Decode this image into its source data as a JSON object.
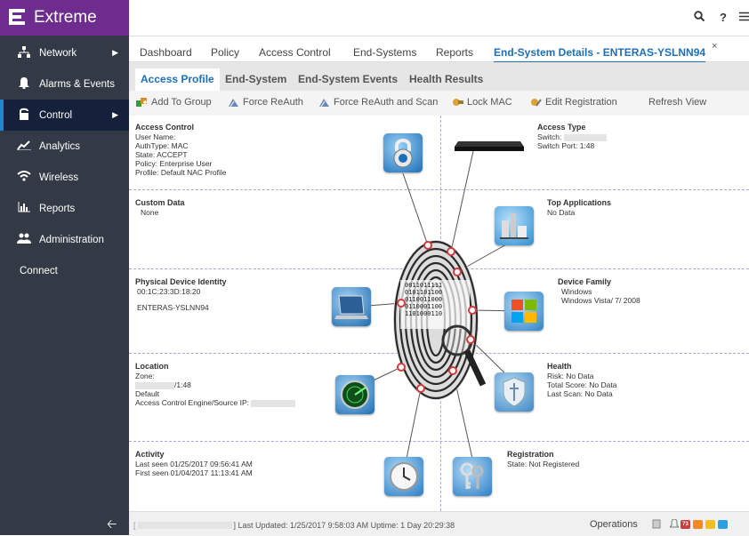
{
  "brand": {
    "name": "Extreme"
  },
  "sidebar": {
    "items": [
      {
        "label": "Network",
        "icon": "network-icon"
      },
      {
        "label": "Alarms & Events",
        "icon": "bell-icon"
      },
      {
        "label": "Control",
        "icon": "lock-icon"
      },
      {
        "label": "Analytics",
        "icon": "analytics-icon"
      },
      {
        "label": "Wireless",
        "icon": "wifi-icon"
      },
      {
        "label": "Reports",
        "icon": "bar-chart-icon"
      },
      {
        "label": "Administration",
        "icon": "users-icon"
      }
    ],
    "connect": "Connect",
    "collapse_icon": "arrow-left-icon"
  },
  "topbar": {
    "icons": [
      "search-icon",
      "help-icon",
      "menu-icon"
    ],
    "help": "?"
  },
  "tabs": [
    "Dashboard",
    "Policy",
    "Access Control",
    "End-Systems",
    "Reports",
    "End-System Details - ENTERAS-YSLNN94"
  ],
  "tab_close": "×",
  "subtabs": [
    "Access Profile",
    "End-System",
    "End-System Events",
    "Health Results"
  ],
  "toolbar": {
    "add_to_group": "Add To Group",
    "force_reauth": "Force ReAuth",
    "force_reauth_scan": "Force ReAuth and Scan",
    "lock_mac": "Lock MAC",
    "edit_registration": "Edit Registration",
    "refresh_view": "Refresh View"
  },
  "sections": {
    "access_control": {
      "title": "Access Control",
      "user_name": "User Name:",
      "auth_type": "AuthType: MAC",
      "state": "State: ACCEPT",
      "policy": "Policy: Enterprise User",
      "profile": "Profile: Default NAC Profile"
    },
    "access_type": {
      "title": "Access Type",
      "switch": "Switch:",
      "switch_port": "Switch Port: 1:48"
    },
    "custom_data": {
      "title": "Custom Data",
      "value": "None"
    },
    "top_applications": {
      "title": "Top Applications",
      "value": "No Data"
    },
    "physical_device": {
      "title": "Physical Device Identity",
      "mac": "00:1C:23:3D:18:20",
      "name": "ENTERAS-YSLNN94"
    },
    "device_family": {
      "title": "Device Family",
      "family": "Windows",
      "version": "Windows Vista/ 7/ 2008"
    },
    "location": {
      "title": "Location",
      "zone": "Zone:",
      "port": "/1:48",
      "default": "Default",
      "engine": "Access Control Engine/Source IP:"
    },
    "health": {
      "title": "Health",
      "risk": "Risk: No Data",
      "total_score": "Total Score: No Data",
      "last_scan": "Last Scan: No Data"
    },
    "activity": {
      "title": "Activity",
      "last_seen": "Last seen 01/25/2017 09:56:41 AM",
      "first_seen": "First seen 01/04/2017 11:13:41 AM"
    },
    "registration": {
      "title": "Registration",
      "state": "State: Not Registered"
    }
  },
  "fingerprint_binary": [
    "0011011111",
    "0101101100",
    "0110011000",
    "0110001100",
    "1101000110"
  ],
  "statusbar": {
    "last_updated": "] Last Updated: 1/25/2017 9:58:03 AM  Uptime: 1 Day 20:29:38",
    "operations": "Operations",
    "alert_count": "73"
  },
  "colors": {
    "brand_purple": "#6e2c8f",
    "sidebar": "#333a45",
    "accent_blue": "#1e6fb8",
    "alert_red": "#d03c3c",
    "alert_orange": "#f0882a",
    "alert_yellow": "#f0c020",
    "alert_blue": "#2aa0e0"
  }
}
